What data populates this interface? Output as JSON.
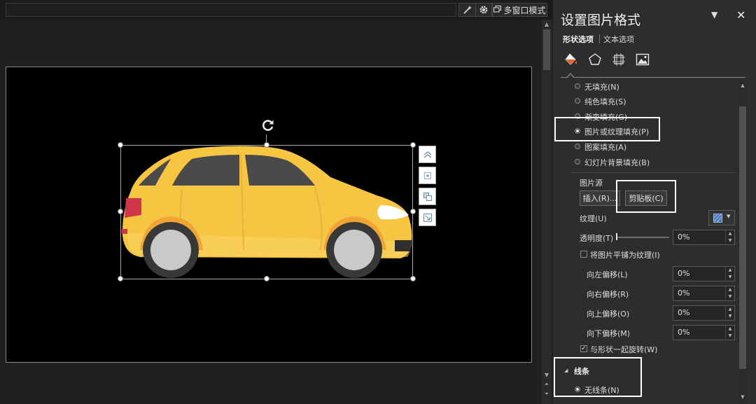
{
  "toolbar": {
    "tools_icon": "wand-tools-icon",
    "settings_icon": "gear-icon",
    "multiwindow_icon": "windows-icon",
    "multiwindow_label": "多窗口模式"
  },
  "canvas": {
    "image_name": "yellow-car",
    "colors": {
      "body": "#f6c542",
      "body_light": "#f9d667",
      "window": "#4a4a4a",
      "tire": "#383838",
      "rim": "#c9c9c9",
      "orange_trim": "#f0a434",
      "tail": "#d0344a"
    }
  },
  "panel": {
    "title": "设置图片格式",
    "menu_icon": "dropdown-arrow-icon",
    "close_label": "✕",
    "tabs": [
      {
        "label": "形状选项",
        "active": true
      },
      {
        "label": "文本选项",
        "active": false
      }
    ],
    "category_icons": [
      "fill-bucket-icon",
      "pentagon-icon",
      "size-layout-icon",
      "picture-icon"
    ],
    "fill_options": [
      {
        "label": "无填充(N)",
        "selected": false
      },
      {
        "label": "纯色填充(S)",
        "selected": false
      },
      {
        "label": "渐变填充(G)",
        "selected": false
      },
      {
        "label": "图片或纹理填充(P)",
        "selected": true
      },
      {
        "label": "图案填充(A)",
        "selected": false
      },
      {
        "label": "幻灯片背景填充(B)",
        "selected": false
      }
    ],
    "picture_source": {
      "label": "图片源",
      "insert_button": "插入(R)...",
      "clipboard_button": "剪贴板(C)"
    },
    "texture": {
      "label": "纹理(U)",
      "icon": "texture-swatch-icon"
    },
    "transparency": {
      "label": "透明度(T)",
      "value": "0%",
      "level": 0
    },
    "tile_checkbox": {
      "label": "将图片平铺为纹理(I)",
      "checked": false
    },
    "offsets": [
      {
        "label": "向左偏移(L)",
        "value": "0%"
      },
      {
        "label": "向右偏移(R)",
        "value": "0%"
      },
      {
        "label": "向上偏移(O)",
        "value": "0%"
      },
      {
        "label": "向下偏移(M)",
        "value": "0%"
      }
    ],
    "rotate_checkbox": {
      "label": "与形状一起旋转(W)",
      "checked": true
    },
    "line_section": {
      "title": "线条",
      "option": "无线条(N)",
      "selected": true
    },
    "highlight_color": "#ffffff"
  }
}
